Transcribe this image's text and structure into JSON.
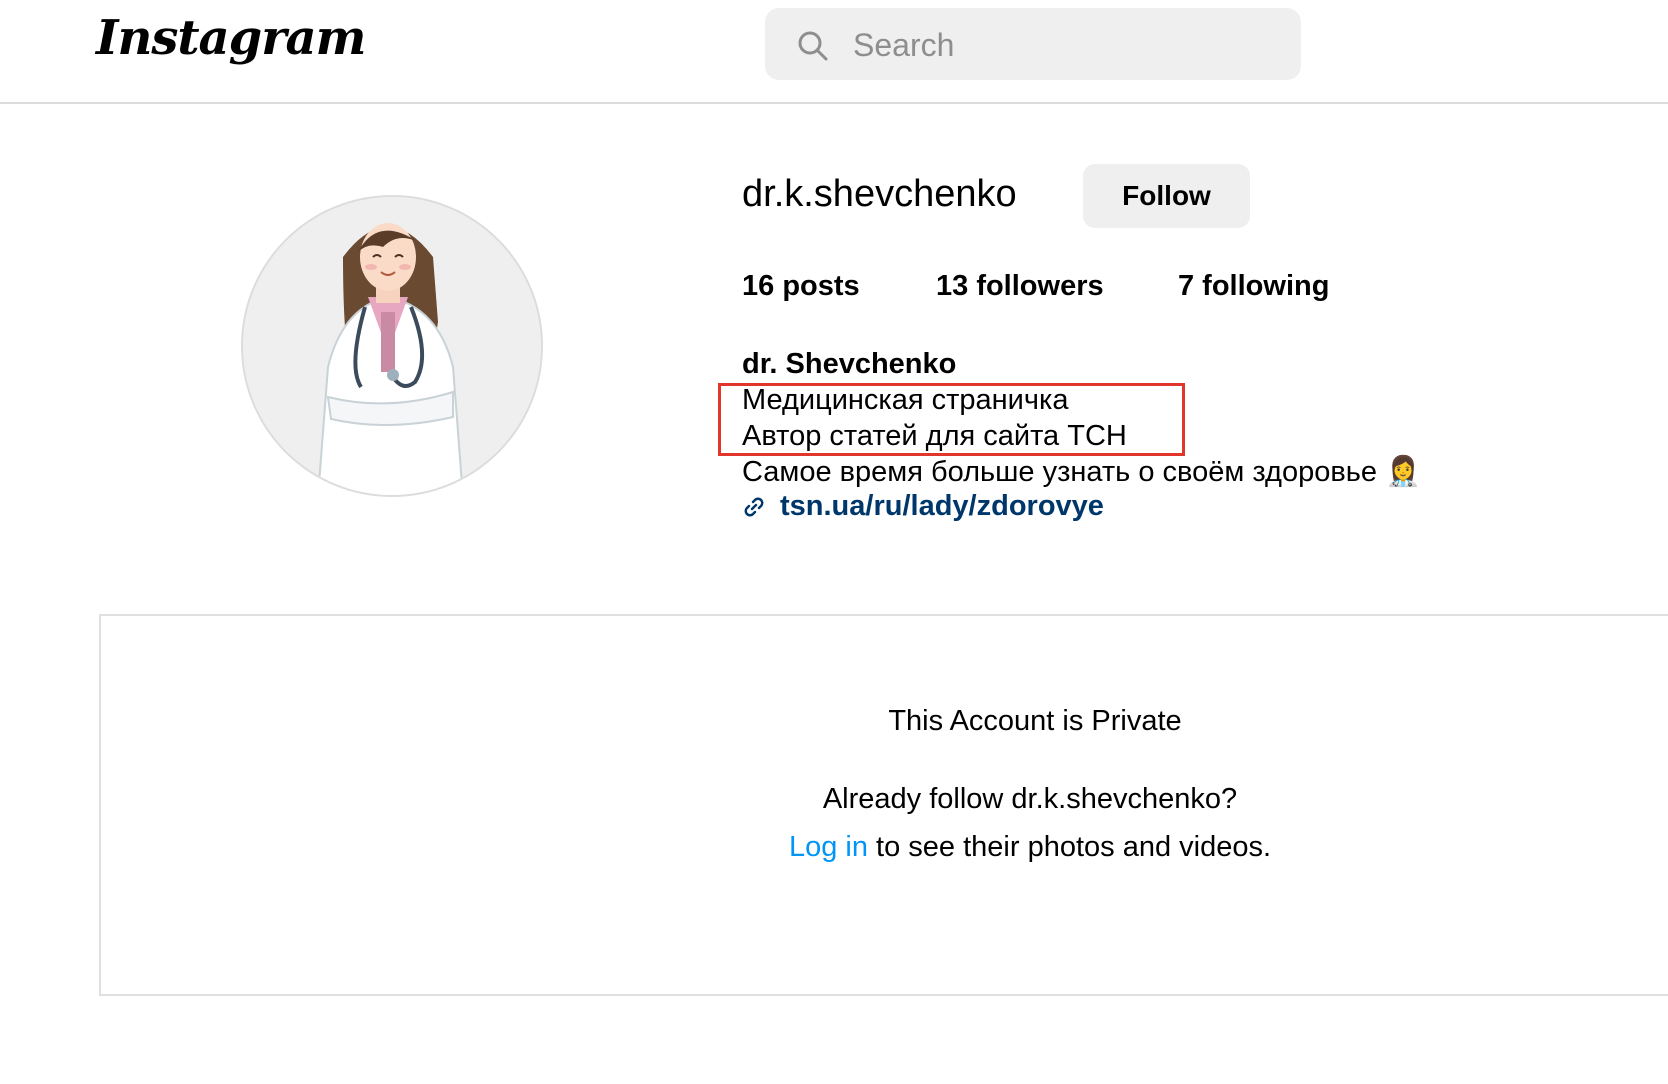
{
  "header": {
    "logo_text": "Instagram",
    "search_placeholder": "Search"
  },
  "profile": {
    "username": "dr.k.shevchenko",
    "follow_label": "Follow",
    "stats": {
      "posts": "16 posts",
      "followers": "13 followers",
      "following": "7 following"
    },
    "full_name": "dr. Shevchenko",
    "bio_lines": [
      "Медицинская страничка",
      "Автор статей для сайта ТСН",
      "Самое время больше узнать о своём здоровье 👩‍⚕️"
    ],
    "link": "tsn.ua/ru/lady/zdorovye"
  },
  "private_notice": {
    "title": "This Account is Private",
    "line1": "Already follow dr.k.shevchenko?",
    "login_label": "Log in",
    "line2_rest": " to see their photos and videos."
  },
  "colors": {
    "highlight_border": "#e0362c",
    "link": "#00376b",
    "login_link": "#0095f6"
  },
  "icons": {
    "search": "search-icon",
    "link": "link-icon",
    "avatar": "doctor-avatar"
  }
}
